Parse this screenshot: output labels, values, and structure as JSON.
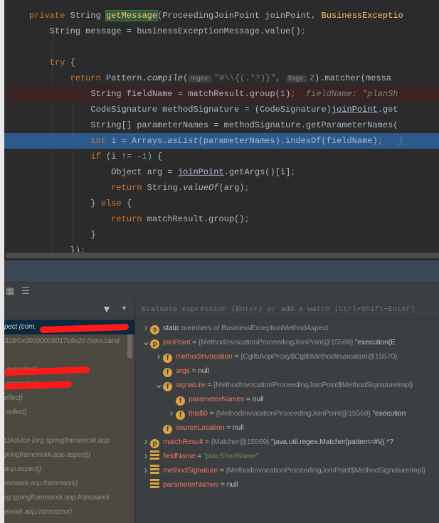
{
  "editor": {
    "lines": [
      {
        "parts": [
          [
            "kw",
            "private "
          ],
          [
            "",
            "String "
          ],
          [
            "fnh",
            "getMessage"
          ],
          [
            "",
            "(ProceedingJoinPoint joinPoint, "
          ],
          [
            "fn",
            "BusinessExceptio"
          ]
        ]
      },
      {
        "parts": [
          [
            "",
            "    String message = businessExceptionMessage.value()"
          ],
          [
            "kw",
            ";"
          ]
        ]
      },
      {
        "parts": []
      },
      {
        "parts": [
          [
            "kw",
            "    try "
          ],
          [
            "",
            "{"
          ]
        ]
      },
      {
        "parts": [
          [
            "kw",
            "        return "
          ],
          [
            "",
            "Pattern."
          ],
          [
            "it",
            "compile"
          ],
          [
            "",
            "("
          ],
          [
            "hint",
            "regex:"
          ],
          [
            "str",
            "\"#\\\\{(.*?)}\""
          ],
          [
            "kw",
            ", "
          ],
          [
            "hint",
            "flags:"
          ],
          [
            "num",
            "2"
          ],
          [
            "",
            ").matcher(messa"
          ]
        ]
      },
      {
        "parts": [
          [
            "",
            "            String fieldName = matchResult.group("
          ],
          [
            "num",
            "1"
          ],
          [
            "",
            ")"
          ],
          [
            "kw",
            ";"
          ],
          [
            "inl",
            "  fieldName: \"planSh"
          ]
        ]
      },
      {
        "parts": [
          [
            "",
            "            CodeSignature methodSignature = (CodeSignature)"
          ],
          [
            "ul",
            "joinPoint"
          ],
          [
            "",
            ".get"
          ]
        ]
      },
      {
        "parts": [
          [
            "",
            "            String[] parameterNames = methodSignature.getParameterNames("
          ]
        ]
      },
      {
        "parts": [
          [
            "kw",
            "            int "
          ],
          [
            "",
            "i = Arrays."
          ],
          [
            "it",
            "asList"
          ],
          [
            "",
            "(parameterNames).indexOf(fieldName)"
          ],
          [
            "kw",
            ";"
          ],
          [
            "inl",
            "   j"
          ]
        ]
      },
      {
        "parts": [
          [
            "kw",
            "            if "
          ],
          [
            "",
            "(i != -"
          ],
          [
            "num",
            "1"
          ],
          [
            "",
            ") {"
          ]
        ]
      },
      {
        "parts": [
          [
            "",
            "                Object arg = "
          ],
          [
            "ul",
            "joinPoint"
          ],
          [
            "",
            ".getArgs()[i]"
          ],
          [
            "kw",
            ";"
          ]
        ]
      },
      {
        "parts": [
          [
            "kw",
            "                return "
          ],
          [
            "",
            "String."
          ],
          [
            "it",
            "valueOf"
          ],
          [
            "",
            "(arg)"
          ],
          [
            "kw",
            ";"
          ]
        ]
      },
      {
        "parts": [
          [
            "",
            "            } "
          ],
          [
            "kw",
            "else "
          ],
          [
            "",
            "{"
          ]
        ]
      },
      {
        "parts": [
          [
            "kw",
            "                return "
          ],
          [
            "",
            "matchResult.group()"
          ],
          [
            "kw",
            ";"
          ]
        ]
      },
      {
        "parts": [
          [
            "",
            "            }"
          ]
        ]
      },
      {
        "parts": [
          [
            "",
            "        })"
          ],
          [
            "kw",
            ";"
          ]
        ]
      }
    ]
  },
  "frames": {
    "items": [
      "pect (com.",
      "328/0x00000008017c9e20 (com.cand",
      "",
      ".exception)",
      ".exception)",
      "eflect)",
      ".reflect)",
      "",
      "tJAdvice (org.springframework.aop",
      "pringframework.aop.aspectj)",
      "aop.aspectj)",
      "mework.aop.framework)",
      "rg.springframework.aop.framework",
      "ework.aop.interceptor)"
    ]
  },
  "variables": {
    "eval_placeholder": "Evaluate expression (Enter) or add a watch (Ctrl+Shift+Enter)",
    "rows": [
      {
        "icon": "s",
        "name": "static",
        "rest": " members of BusinessExceptionMethodAspect"
      },
      {
        "icon": "p",
        "name": "joinPoint",
        "eq": " = ",
        "val": "{MethodInvocationProceedingJoinPoint@15568}",
        "tail": " \"execution(E"
      },
      {
        "icon": "f",
        "name": "methodInvocation",
        "eq": " = ",
        "val": "{CglibAopProxy$CglibMethodInvocation@15570}"
      },
      {
        "icon": "f",
        "name": "args",
        "eq": " = ",
        "tail": "null"
      },
      {
        "icon": "f",
        "name": "signature",
        "eq": " = ",
        "val": "{MethodInvocationProceedingJoinPoint$MethodSignatureImpl}"
      },
      {
        "icon": "f",
        "name": "parameterNames",
        "eq": " = ",
        "tail": "null"
      },
      {
        "icon": "f",
        "name": "this$0",
        "eq": " = ",
        "val": "{MethodInvocationProceedingJoinPoint@15568}",
        "tail": " \"execution"
      },
      {
        "icon": "f",
        "name": "sourceLocation",
        "eq": " = ",
        "tail": "null"
      },
      {
        "icon": "p",
        "name": "matchResult",
        "eq": " = ",
        "val": "{Matcher@15569}",
        "tail": " \"java.util.regex.Matcher[pattern=#\\{(.*?"
      },
      {
        "icon": "list",
        "name": "fieldName",
        "eq": " = ",
        "str": "\"planShortName\""
      },
      {
        "icon": "list",
        "name": "methodSignature",
        "eq": " = ",
        "val": "{MethodInvocationProceedingJoinPoint$MethodSignatureImpl}"
      },
      {
        "icon": "list",
        "name": "parameterNames",
        "eq": " = ",
        "tail": "null"
      }
    ]
  }
}
